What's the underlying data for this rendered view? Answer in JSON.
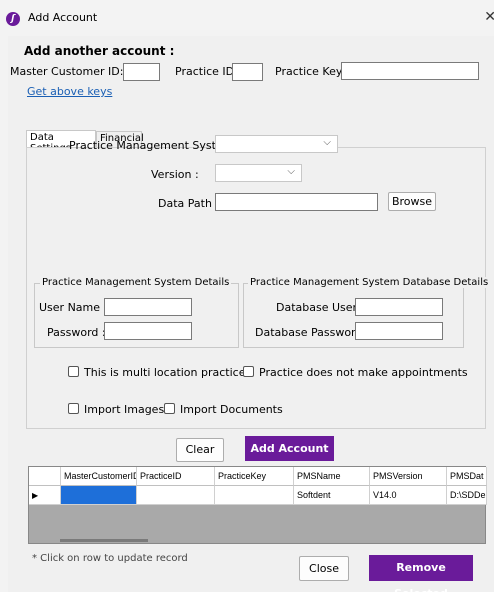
{
  "window": {
    "title": "Add Account",
    "icon": "app-logo-icon",
    "close_glyph": "✕"
  },
  "form": {
    "heading": "Add another account :",
    "master_customer_id_label": "Master Customer ID:",
    "master_customer_id_value": "",
    "practice_id_label": "Practice ID:",
    "practice_id_value": "",
    "practice_key_label": "Practice Key:",
    "practice_key_value": "",
    "get_keys_link": "Get above keys"
  },
  "tabs": [
    {
      "label": "Data Settings",
      "active": true
    },
    {
      "label": "Financial",
      "active": false
    }
  ],
  "data_settings": {
    "pms_label": "Practice Management System :",
    "pms_value": "",
    "version_label": "Version :",
    "version_value": "",
    "data_path_label": "Data Path :",
    "data_path_value": "",
    "browse_label": "Browse"
  },
  "pms_details": {
    "legend": "Practice Management System Details",
    "username_label": "User Name :",
    "username_value": "",
    "password_label": "Password :",
    "password_value": ""
  },
  "db_details": {
    "legend": "Practice Management System Database Details",
    "db_user_label": "Database User :",
    "db_user_value": "",
    "db_password_label": "Database Password :",
    "db_password_value": ""
  },
  "options": {
    "multi_location": "This is multi location practice",
    "no_appointments": "Practice does not make appointments",
    "import_images": "Import Images",
    "import_documents": "Import Documents"
  },
  "actions": {
    "clear": "Clear",
    "add_account": "Add Account"
  },
  "grid": {
    "columns": [
      "MasterCustomerID",
      "PracticeID",
      "PracticeKey",
      "PMSName",
      "PMSVersion",
      "PMSDat"
    ],
    "rows": [
      {
        "MasterCustomerID": "",
        "PracticeID": "",
        "PracticeKey": "",
        "PMSName": "Softdent",
        "PMSVersion": "V14.0",
        "PMSDat": "D:\\SDDe"
      }
    ],
    "row_marker": "▶"
  },
  "footer": {
    "hint": "* Click on row to update record",
    "close": "Close",
    "remove_selected": "Remove Selected"
  },
  "colors": {
    "accent": "#6a1b9a",
    "link": "#1a5fb4",
    "selection": "#1e6fd9"
  }
}
